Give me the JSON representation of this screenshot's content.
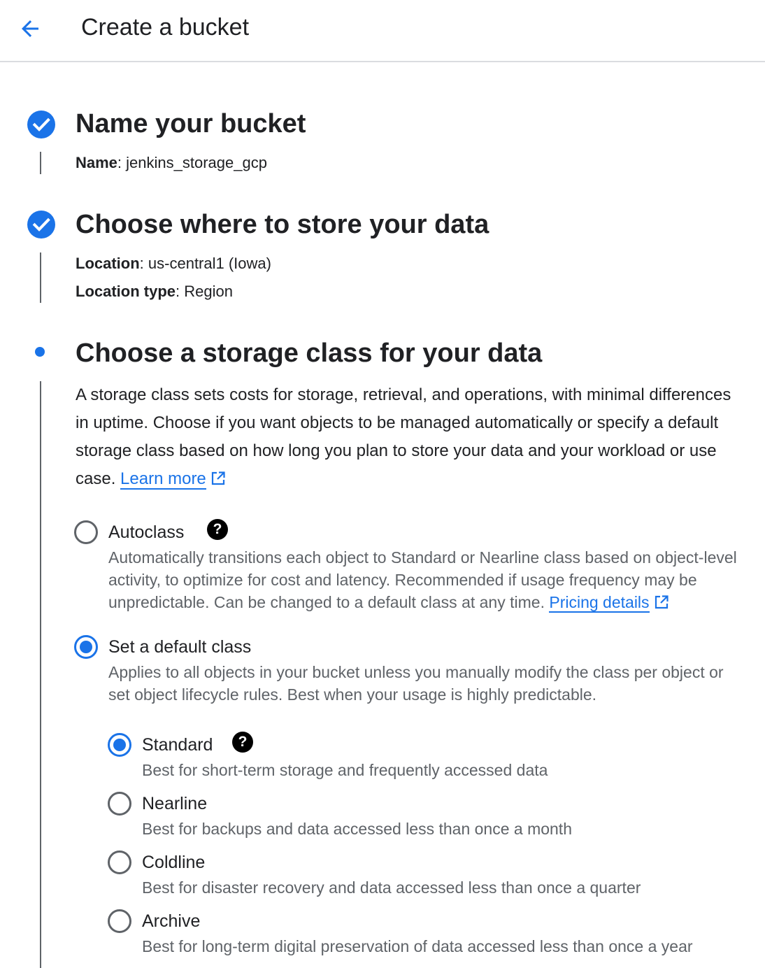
{
  "header": {
    "title": "Create a bucket",
    "back_icon": "arrow-back-icon"
  },
  "steps": [
    {
      "title": "Name your bucket",
      "status": "completed",
      "fields": [
        {
          "label": "Name",
          "value": "jenkins_storage_gcp"
        }
      ]
    },
    {
      "title": "Choose where to store your data",
      "status": "completed",
      "fields": [
        {
          "label": "Location",
          "value": "us-central1 (Iowa)"
        },
        {
          "label": "Location type",
          "value": "Region"
        }
      ]
    },
    {
      "title": "Choose a storage class for your data",
      "status": "active",
      "description": "A storage class sets costs for storage, retrieval, and operations, with minimal differences in uptime. Choose if you want objects to be managed automatically or specify a default storage class based on how long you plan to store your data and your workload or use case.",
      "learn_more": "Learn more",
      "options": [
        {
          "label": "Autoclass",
          "checked": false,
          "description": "Automatically transitions each object to Standard or Nearline class based on object-level activity, to optimize for cost and latency. Recommended if usage frequency may be unpredictable. Can be changed to a default class at any time.",
          "link": "Pricing details"
        },
        {
          "label": "Set a default class",
          "checked": true,
          "description": "Applies to all objects in your bucket unless you manually modify the class per object or set object lifecycle rules. Best when your usage is highly predictable."
        }
      ],
      "classes": [
        {
          "label": "Standard",
          "checked": true,
          "description": "Best for short-term storage and frequently accessed data"
        },
        {
          "label": "Nearline",
          "checked": false,
          "description": "Best for backups and data accessed less than once a month"
        },
        {
          "label": "Coldline",
          "checked": false,
          "description": "Best for disaster recovery and data accessed less than once a quarter"
        },
        {
          "label": "Archive",
          "checked": false,
          "description": "Best for long-term digital preservation of data accessed less than once a year"
        }
      ]
    }
  ],
  "colors": {
    "accent": "#1a73e8",
    "text": "#202124",
    "secondary_text": "#5f6368",
    "divider": "#dadce0"
  },
  "icons": {
    "completed": "check-circle-icon",
    "help": "help-icon",
    "external": "open-in-new-icon"
  }
}
